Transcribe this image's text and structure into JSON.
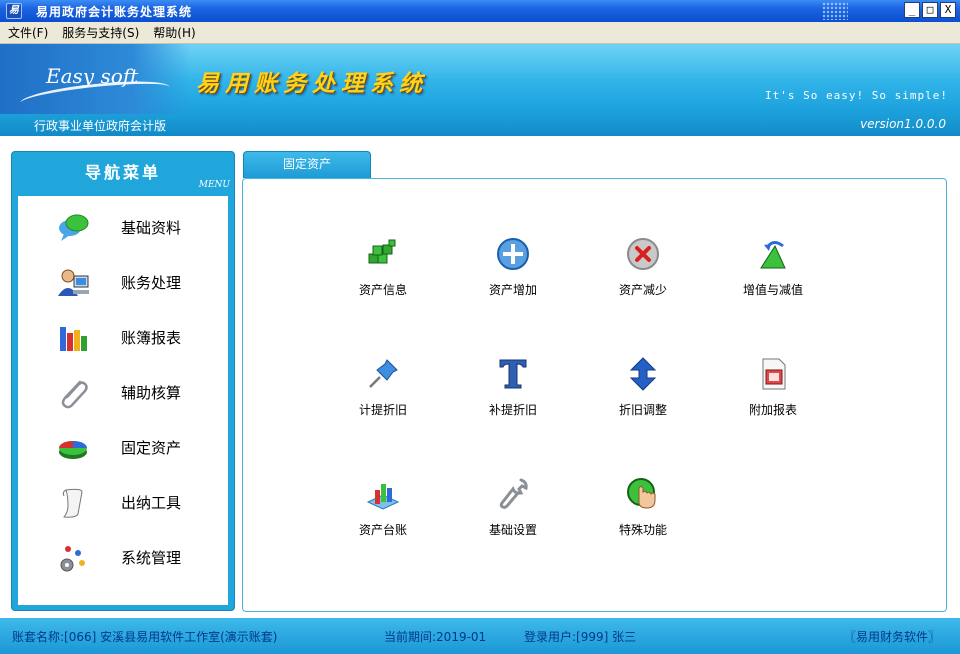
{
  "window": {
    "title": "易用政府会计账务处理系统",
    "app_icon": "易",
    "buttons": [
      "_",
      "□",
      "X"
    ]
  },
  "menu": [
    {
      "label": "文件(F)"
    },
    {
      "label": "服务与支持(S)"
    },
    {
      "label": "帮助(H)"
    }
  ],
  "banner": {
    "logo_text": "Easy soft",
    "title": "易用账务处理系统",
    "slogan": "It's So easy! So simple!",
    "edition": "行政事业单位政府会计版",
    "version": "version1.0.0.0"
  },
  "nav": {
    "title": "导航菜单",
    "subtitle": "MENU",
    "items": [
      {
        "label": "基础资料",
        "icon": "chat-bubbles-icon"
      },
      {
        "label": "账务处理",
        "icon": "user-computer-icon"
      },
      {
        "label": "账簿报表",
        "icon": "bar-chart-icon"
      },
      {
        "label": "辅助核算",
        "icon": "paperclip-icon"
      },
      {
        "label": "固定资产",
        "icon": "pie-chart-icon"
      },
      {
        "label": "出纳工具",
        "icon": "scroll-icon"
      },
      {
        "label": "系统管理",
        "icon": "gears-icon"
      }
    ]
  },
  "tab": {
    "label": "固定资产"
  },
  "tools": [
    {
      "label": "资产信息",
      "icon": "green-cubes-icon"
    },
    {
      "label": "资产增加",
      "icon": "add-circle-icon"
    },
    {
      "label": "资产减少",
      "icon": "remove-circle-icon"
    },
    {
      "label": "增值与减值",
      "icon": "triangle-arrow-icon"
    },
    {
      "label": "计提折旧",
      "icon": "pushpin-icon"
    },
    {
      "label": "补提折旧",
      "icon": "letter-t-icon"
    },
    {
      "label": "折旧调整",
      "icon": "up-down-arrow-icon"
    },
    {
      "label": "附加报表",
      "icon": "report-document-icon"
    },
    {
      "label": "资产台账",
      "icon": "ledger-chart-icon"
    },
    {
      "label": "基础设置",
      "icon": "wrench-icon"
    },
    {
      "label": "特殊功能",
      "icon": "hand-button-icon"
    }
  ],
  "status": {
    "account": "账套名称:[066] 安溪县易用软件工作室(演示账套)",
    "period": "当前期间:2019-01",
    "user": "登录用户:[999] 张三",
    "brand": "〖易用财务软件〗"
  }
}
